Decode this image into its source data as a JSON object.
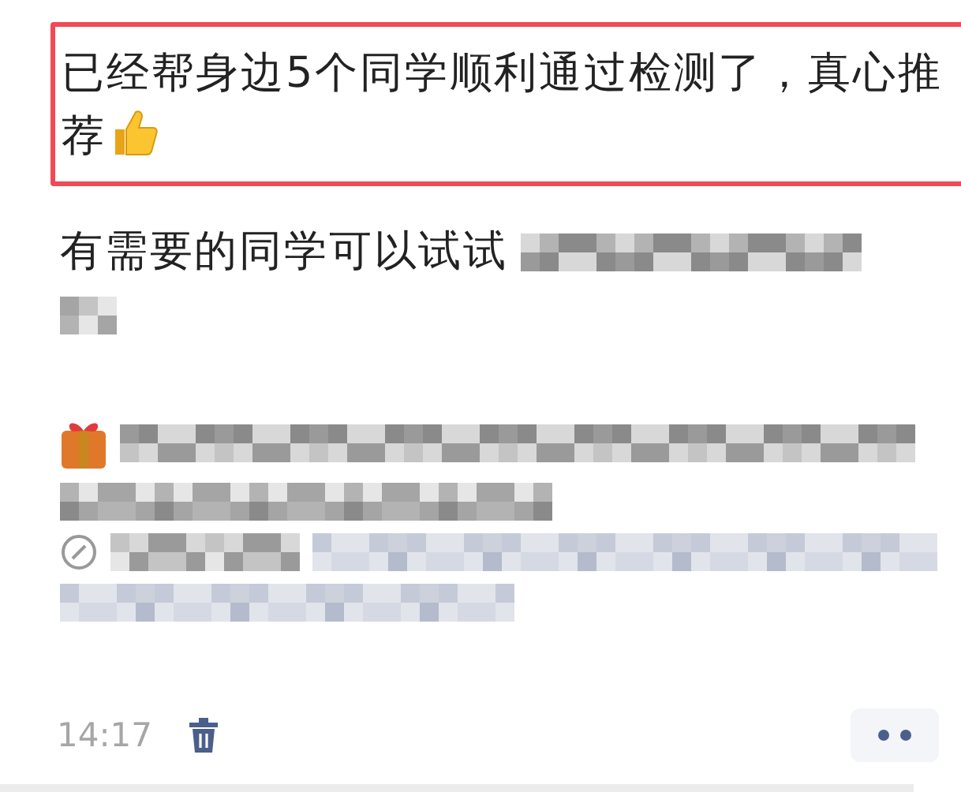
{
  "message": {
    "highlight": {
      "text": "已经帮身边5个同学顺利通过检测了，真心推荐",
      "highlighted": true
    },
    "body_text": "有需要的同学可以试试",
    "time": "14:17"
  }
}
